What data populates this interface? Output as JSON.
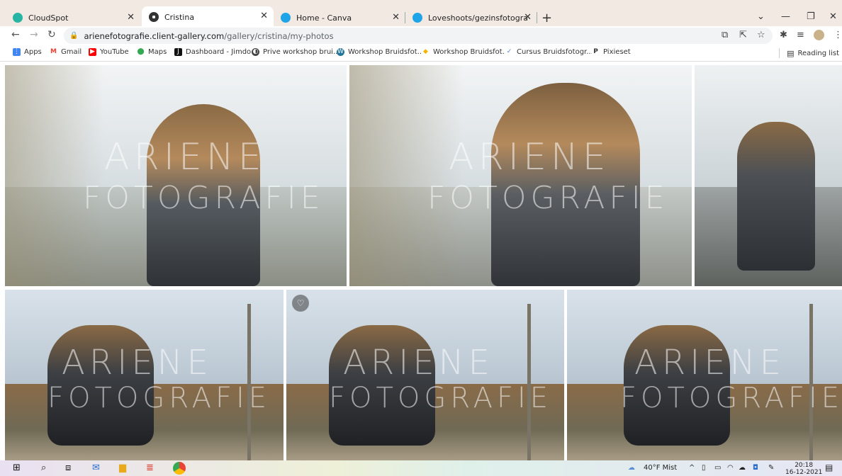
{
  "browser": {
    "tabs": [
      {
        "title": "CloudSpot",
        "favicon_color": "#26b5a3"
      },
      {
        "title": "Cristina",
        "favicon_color": "#333333",
        "active": true
      },
      {
        "title": "Home - Canva",
        "favicon_color": "#20a4e8"
      },
      {
        "title": "Loveshoots/gezinsfotografie/bru",
        "favicon_color": "#20a4e8"
      }
    ],
    "url_host": "arienefotografie.client-gallery.com",
    "url_path": "/gallery/cristina/my-photos",
    "bookmarks": [
      {
        "label": "Apps",
        "icon": "apps-grid-icon",
        "color": "#4285f4"
      },
      {
        "label": "Gmail",
        "icon": "gmail-icon",
        "color": "#ea4335"
      },
      {
        "label": "YouTube",
        "icon": "youtube-icon",
        "color": "#ff0000"
      },
      {
        "label": "Maps",
        "icon": "maps-icon",
        "color": "#34a853"
      },
      {
        "label": "Dashboard - Jimdo",
        "icon": "jimdo-icon",
        "color": "#111111"
      },
      {
        "label": "Prive workshop brui...",
        "icon": "globe-icon",
        "color": "#444444"
      },
      {
        "label": "Workshop Bruidsfot...",
        "icon": "wordpress-icon",
        "color": "#21759b"
      },
      {
        "label": "Workshop Bruidsfot...",
        "icon": "diamond-icon",
        "color": "#f4b400"
      },
      {
        "label": "Cursus Bruidsfotogr...",
        "icon": "badge-icon",
        "color": "#5b7fc4"
      },
      {
        "label": "Pixieset",
        "icon": "pixieset-icon",
        "color": "#333333"
      }
    ],
    "reading_list": "Reading list"
  },
  "gallery": {
    "watermark_line1": "ARIENE",
    "watermark_line2": "FOTOGRAFIE",
    "favorite_icon": "heart-icon"
  },
  "taskbar": {
    "weather": "40°F  Mist",
    "time": "20:18",
    "date": "16-12-2021"
  }
}
